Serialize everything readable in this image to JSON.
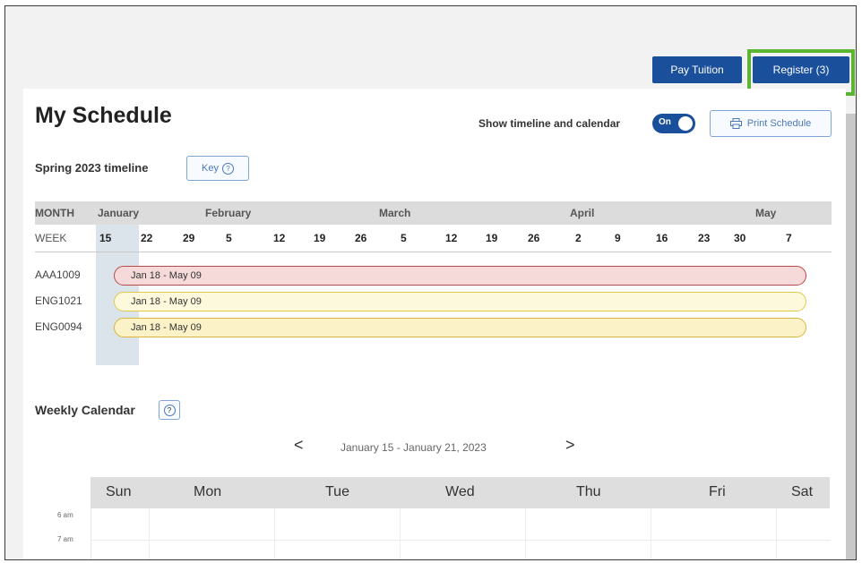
{
  "header": {
    "pay_tuition": "Pay Tuition",
    "register": "Register (3)"
  },
  "page_title": "My Schedule",
  "toggle": {
    "label": "Show timeline and calendar",
    "state": "On"
  },
  "print_button": "Print Schedule",
  "timeline": {
    "title": "Spring 2023 timeline",
    "key_button": "Key",
    "month_header": "MONTH",
    "week_header": "WEEK",
    "months": [
      "January",
      "February",
      "March",
      "April",
      "May"
    ],
    "weeks": [
      "15",
      "22",
      "29",
      "5",
      "12",
      "19",
      "26",
      "5",
      "12",
      "19",
      "26",
      "2",
      "9",
      "16",
      "23",
      "30",
      "7"
    ],
    "courses": [
      {
        "code": "AAA1009",
        "range": "Jan 18 - May 09",
        "color": "#f6dada",
        "border": "#b94a4a"
      },
      {
        "code": "ENG1021",
        "range": "Jan 18 - May 09",
        "color": "#fdf9dc",
        "border": "#e2c84a"
      },
      {
        "code": "ENG0094",
        "range": "Jan 18 - May 09",
        "color": "#fbf2c8",
        "border": "#d9b53a"
      }
    ]
  },
  "weekly": {
    "title": "Weekly Calendar",
    "prev": "<",
    "next": ">",
    "range": "January 15 - January 21, 2023",
    "days": [
      "Sun",
      "Mon",
      "Tue",
      "Wed",
      "Thu",
      "Fri",
      "Sat"
    ],
    "times": [
      "6 am",
      "7 am"
    ]
  },
  "colors": {
    "primary": "#1a4f9c",
    "highlight": "#5cb531"
  },
  "icons": {
    "print": "printer-icon",
    "help": "question-circle-icon",
    "prev": "chevron-left-icon",
    "next": "chevron-right-icon"
  }
}
